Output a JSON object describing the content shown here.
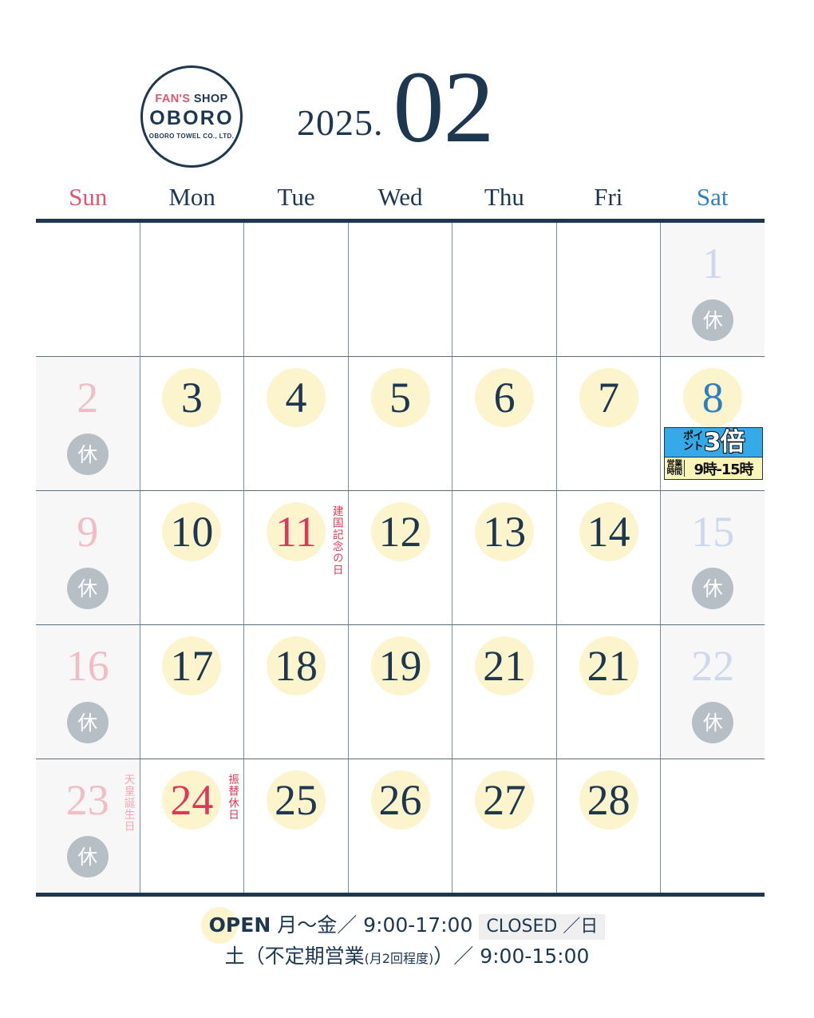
{
  "logo": {
    "line1_accent": "FAN'S",
    "line1_rest": "SHOP",
    "line2": "OBORO",
    "line3": "OBORO TOWEL CO., LTD."
  },
  "title": {
    "year": "2025.",
    "month": "02"
  },
  "weekdays": [
    {
      "label": "Sun",
      "tone": "sun"
    },
    {
      "label": "Mon",
      "tone": "weekday"
    },
    {
      "label": "Tue",
      "tone": "weekday"
    },
    {
      "label": "Wed",
      "tone": "weekday"
    },
    {
      "label": "Thu",
      "tone": "weekday"
    },
    {
      "label": "Fri",
      "tone": "weekday"
    },
    {
      "label": "Sat",
      "tone": "sat"
    }
  ],
  "rest_mark": "休",
  "promo": {
    "points_small_top": "ポイ",
    "points_small_bottom": "ント",
    "points_big": "3倍",
    "hours_label_top": "営業",
    "hours_label_bottom": "時間",
    "hours_value": "9時-15時"
  },
  "weeks": [
    {
      "days": [
        {
          "num": "",
          "style": "empty"
        },
        {
          "num": "",
          "style": "empty"
        },
        {
          "num": "",
          "style": "empty"
        },
        {
          "num": "",
          "style": "empty"
        },
        {
          "num": "",
          "style": "empty"
        },
        {
          "num": "",
          "style": "empty"
        },
        {
          "num": "1",
          "style": "sat-closed",
          "rest": true
        }
      ]
    },
    {
      "days": [
        {
          "num": "2",
          "style": "sun-closed",
          "rest": true
        },
        {
          "num": "3",
          "style": "open"
        },
        {
          "num": "4",
          "style": "open"
        },
        {
          "num": "5",
          "style": "open"
        },
        {
          "num": "6",
          "style": "open"
        },
        {
          "num": "7",
          "style": "open"
        },
        {
          "num": "8",
          "style": "sat-open",
          "promo": true
        }
      ]
    },
    {
      "days": [
        {
          "num": "9",
          "style": "sun-closed",
          "rest": true
        },
        {
          "num": "10",
          "style": "open"
        },
        {
          "num": "11",
          "style": "holiday",
          "label": "建国記念の日",
          "label_tone": "red"
        },
        {
          "num": "12",
          "style": "open"
        },
        {
          "num": "13",
          "style": "open"
        },
        {
          "num": "14",
          "style": "open"
        },
        {
          "num": "15",
          "style": "sat-closed",
          "rest": true
        }
      ]
    },
    {
      "days": [
        {
          "num": "16",
          "style": "sun-closed",
          "rest": true
        },
        {
          "num": "17",
          "style": "open"
        },
        {
          "num": "18",
          "style": "open"
        },
        {
          "num": "19",
          "style": "open"
        },
        {
          "num": "21",
          "style": "open"
        },
        {
          "num": "21",
          "style": "open"
        },
        {
          "num": "22",
          "style": "sat-closed",
          "rest": true
        }
      ]
    },
    {
      "days": [
        {
          "num": "23",
          "style": "sun-closed",
          "rest": true,
          "label": "天皇誕生日",
          "label_tone": "pink"
        },
        {
          "num": "24",
          "style": "holiday",
          "label": "振替休日",
          "label_tone": "red"
        },
        {
          "num": "25",
          "style": "open"
        },
        {
          "num": "26",
          "style": "open"
        },
        {
          "num": "27",
          "style": "open"
        },
        {
          "num": "28",
          "style": "open"
        },
        {
          "num": "",
          "style": "empty"
        }
      ]
    }
  ],
  "footer": {
    "open_word": "OPEN",
    "open_days": " 月～金／ 9:00-17:00",
    "closed_chip": "CLOSED ／日",
    "line2_a": "土（不定期営業",
    "line2_note": "(月2回程度)",
    "line2_b": "）／ 9:00-15:00"
  },
  "colors": {
    "navy": "#1d3751",
    "sunday_red": "#e0566e",
    "saturday_blue": "#2e7fc1",
    "holiday_red": "#d93a57",
    "highlight_yellow": "#fbf4cd",
    "rest_gray": "#b6bec6",
    "promo_blue": "#36a9e8",
    "promo_yellow": "#fbf6b8"
  }
}
